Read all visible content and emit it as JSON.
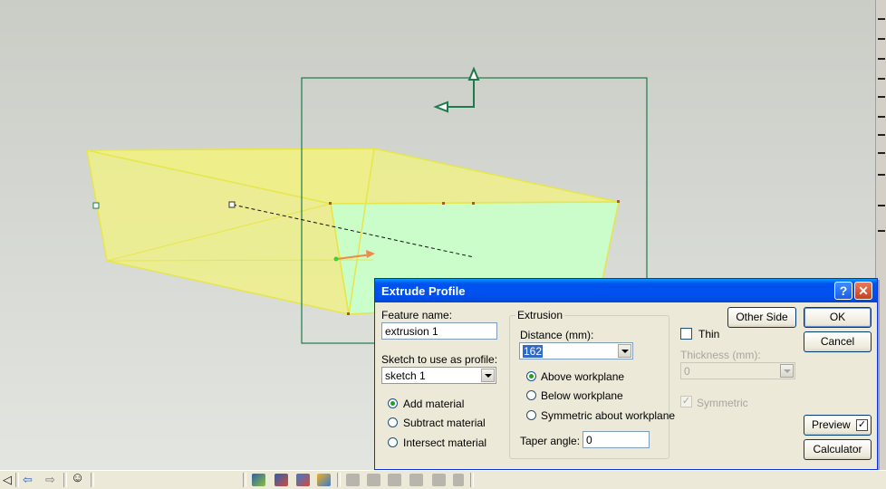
{
  "dialog": {
    "title": "Extrude Profile",
    "help_button": "?",
    "close_button": "✕",
    "feature_name_label": "Feature name:",
    "feature_name_value": "extrusion 1",
    "sketch_label": "Sketch to use as profile:",
    "sketch_value": "sketch 1",
    "material_options": [
      {
        "label": "Add material",
        "selected": true
      },
      {
        "label": "Subtract material",
        "selected": false
      },
      {
        "label": "Intersect material",
        "selected": false
      }
    ],
    "extrusion_group_title": "Extrusion",
    "distance_label": "Distance (mm):",
    "distance_value": "162",
    "workplane_options": [
      {
        "label": "Above workplane",
        "selected": true
      },
      {
        "label": "Below workplane",
        "selected": false
      },
      {
        "label": "Symmetric about workplane",
        "selected": false
      }
    ],
    "taper_label": "Taper angle:",
    "taper_value": "0",
    "thin_label": "Thin",
    "thin_checked": false,
    "thickness_label": "Thickness (mm):",
    "thickness_value": "0",
    "symmetric_label": "Symmetric",
    "symmetric_checked": true,
    "other_side_button": "Other Side",
    "ok_button": "OK",
    "cancel_button": "Cancel",
    "preview_button": "Preview",
    "preview_checked": true,
    "calculator_button": "Calculator"
  },
  "statusbar": {
    "icons": [
      "triangle-left-icon",
      "back-arrow-icon",
      "forward-arrow-icon",
      "smiley-icon"
    ],
    "tools": [
      "extrude-tool-icon",
      "revolve-tool-icon",
      "sweep-tool-icon",
      "loft-tool-icon",
      "shell-tool-icon",
      "fillet-tool-icon",
      "chamfer-tool-icon",
      "draft-tool-icon",
      "pattern-tool-icon"
    ]
  },
  "colors": {
    "solid_fill": "#eef08a",
    "solid_edge": "#e6e64a",
    "profile_face": "#c9ffc9",
    "workplane": "#1e7a4a",
    "titlebar": "#0054e3"
  }
}
